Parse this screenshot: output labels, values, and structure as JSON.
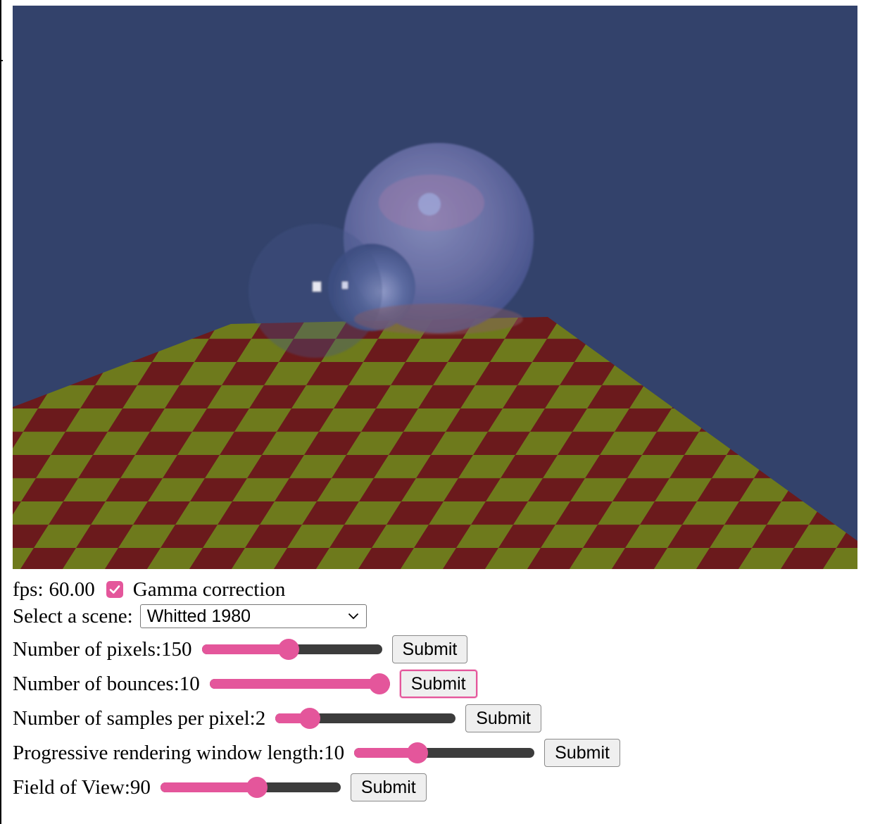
{
  "render": {
    "scene_image": "ray-traced-checkerboard-glass-spheres",
    "colors": {
      "sky": "#33426b",
      "checker_red": "#6b1a1c",
      "checker_yellow": "#6e7a1c",
      "accent": "#e4569b"
    }
  },
  "status": {
    "fps_label": "fps:",
    "fps_value": "60.00",
    "gamma_label": "Gamma correction",
    "gamma_checked": true
  },
  "scene": {
    "label": "Select a scene:",
    "selected": "Whitted 1980"
  },
  "controls": [
    {
      "label": "Number of pixels:",
      "value": "150",
      "fraction": 0.48,
      "button": "Submit",
      "focused": false
    },
    {
      "label": "Number of bounces:",
      "value": "10",
      "fraction": 1.0,
      "button": "Submit",
      "focused": true
    },
    {
      "label": "Number of samples per pixel:",
      "value": "2",
      "fraction": 0.15,
      "button": "Submit",
      "focused": false
    },
    {
      "label": "Progressive rendering window length:",
      "value": "10",
      "fraction": 0.33,
      "button": "Submit",
      "focused": false
    },
    {
      "label": "Field of View:",
      "value": "90",
      "fraction": 0.54,
      "button": "Submit",
      "focused": false
    }
  ]
}
